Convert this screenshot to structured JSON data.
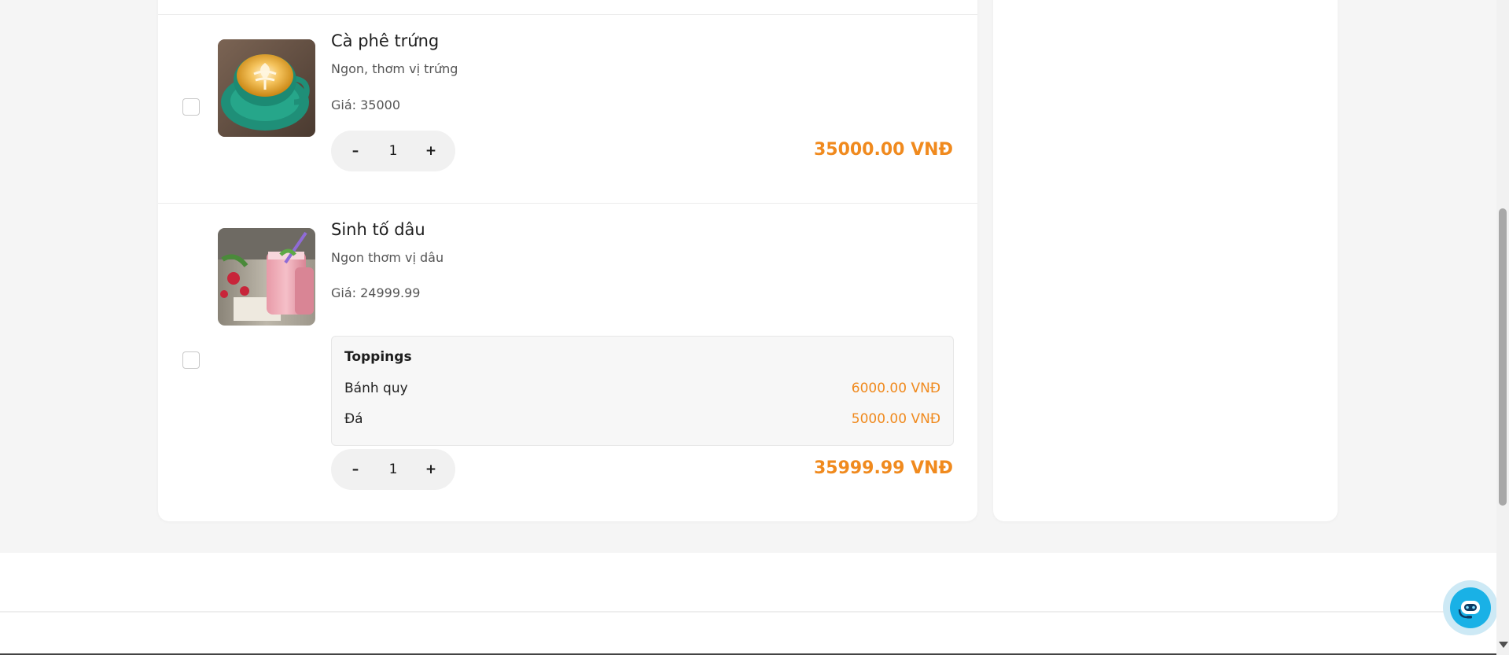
{
  "cart": {
    "items": [
      {
        "name": "Cà phê trứng",
        "description": "Ngon, thơm vị trứng",
        "price_label": "Giá: 35000",
        "quantity": "1",
        "line_total": "35000.00 VNĐ",
        "image_icon": "egg-coffee-image"
      },
      {
        "name": "Sinh tố dâu",
        "description": "Ngon thơm vị dâu",
        "price_label": "Giá: 24999.99",
        "quantity": "1",
        "line_total": "35999.99 VNĐ",
        "image_icon": "strawberry-smoothie-image",
        "toppings": {
          "title": "Toppings",
          "list": [
            {
              "name": "Bánh quy",
              "price": "6000.00 VNĐ"
            },
            {
              "name": "Đá",
              "price": "5000.00 VNĐ"
            }
          ]
        }
      }
    ],
    "stepper": {
      "minus": "–",
      "plus": "+"
    }
  },
  "colors": {
    "accent": "#f08a1e",
    "chat_button": "#19b1e6",
    "page_bg": "#f5f5f5"
  },
  "chat": {
    "icon": "chat-robot-icon"
  }
}
